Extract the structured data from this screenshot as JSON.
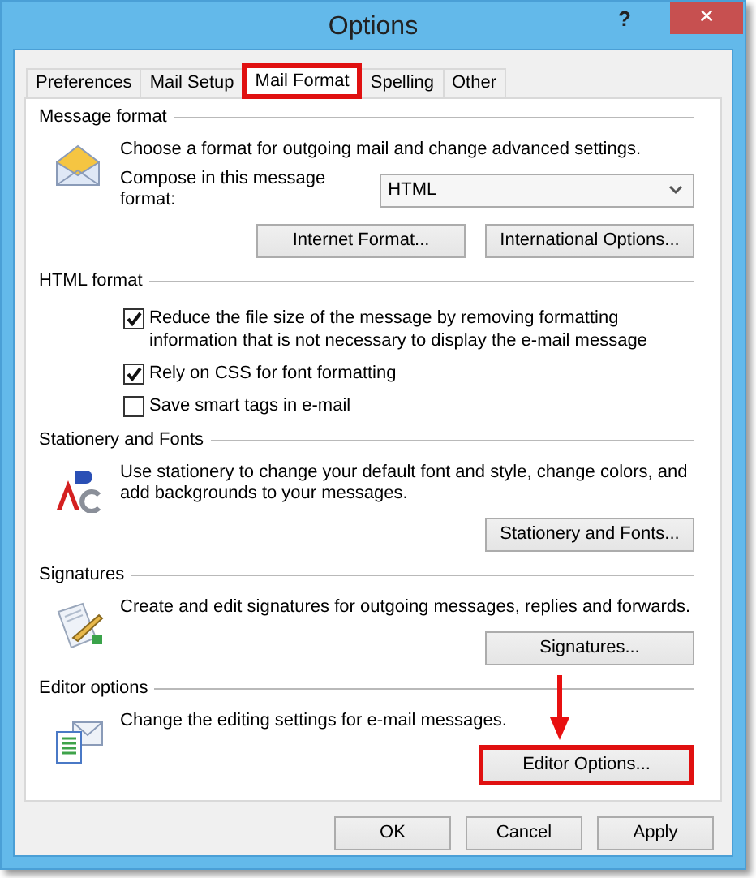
{
  "window": {
    "title": "Options",
    "help": "?",
    "close": "×"
  },
  "tabs": [
    {
      "label": "Preferences",
      "selected": false,
      "highlighted": false
    },
    {
      "label": "Mail Setup",
      "selected": false,
      "highlighted": false
    },
    {
      "label": "Mail Format",
      "selected": true,
      "highlighted": true
    },
    {
      "label": "Spelling",
      "selected": false,
      "highlighted": false
    },
    {
      "label": "Other",
      "selected": false,
      "highlighted": false
    }
  ],
  "sections": [
    {
      "kind": "format",
      "title": "Message format",
      "description": "Choose a format for outgoing mail and change advanced settings.",
      "compose_label": "Compose in this message format:",
      "compose_value": "HTML",
      "buttons": [
        {
          "label": "Internet Format...",
          "highlighted": false,
          "pointer_arrow": false
        },
        {
          "label": "International Options...",
          "highlighted": false,
          "pointer_arrow": false
        }
      ]
    },
    {
      "kind": "checks",
      "title": "HTML format",
      "options": [
        {
          "label": "Reduce the file size of the message by removing formatting information that is not necessary to display the e-mail message",
          "checked": true
        },
        {
          "label": "Rely on CSS for font formatting",
          "checked": true
        },
        {
          "label": "Save smart tags in e-mail",
          "checked": false
        }
      ]
    },
    {
      "kind": "info",
      "title": "Stationery and Fonts",
      "description": "Use stationery to change your default font and style, change colors, and add backgrounds to your messages.",
      "buttons": [
        {
          "label": "Stationery and Fonts...",
          "highlighted": false,
          "pointer_arrow": false
        }
      ]
    },
    {
      "kind": "info",
      "title": "Signatures",
      "description": "Create and edit signatures for outgoing messages, replies and forwards.",
      "buttons": [
        {
          "label": "Signatures...",
          "highlighted": false,
          "pointer_arrow": false
        }
      ]
    },
    {
      "kind": "info",
      "title": "Editor options",
      "description": "Change the editing settings for e-mail messages.",
      "buttons": [
        {
          "label": "Editor Options...",
          "highlighted": true,
          "pointer_arrow": true
        }
      ]
    }
  ],
  "footer_buttons": [
    {
      "label": "OK"
    },
    {
      "label": "Cancel"
    },
    {
      "label": "Apply"
    }
  ]
}
